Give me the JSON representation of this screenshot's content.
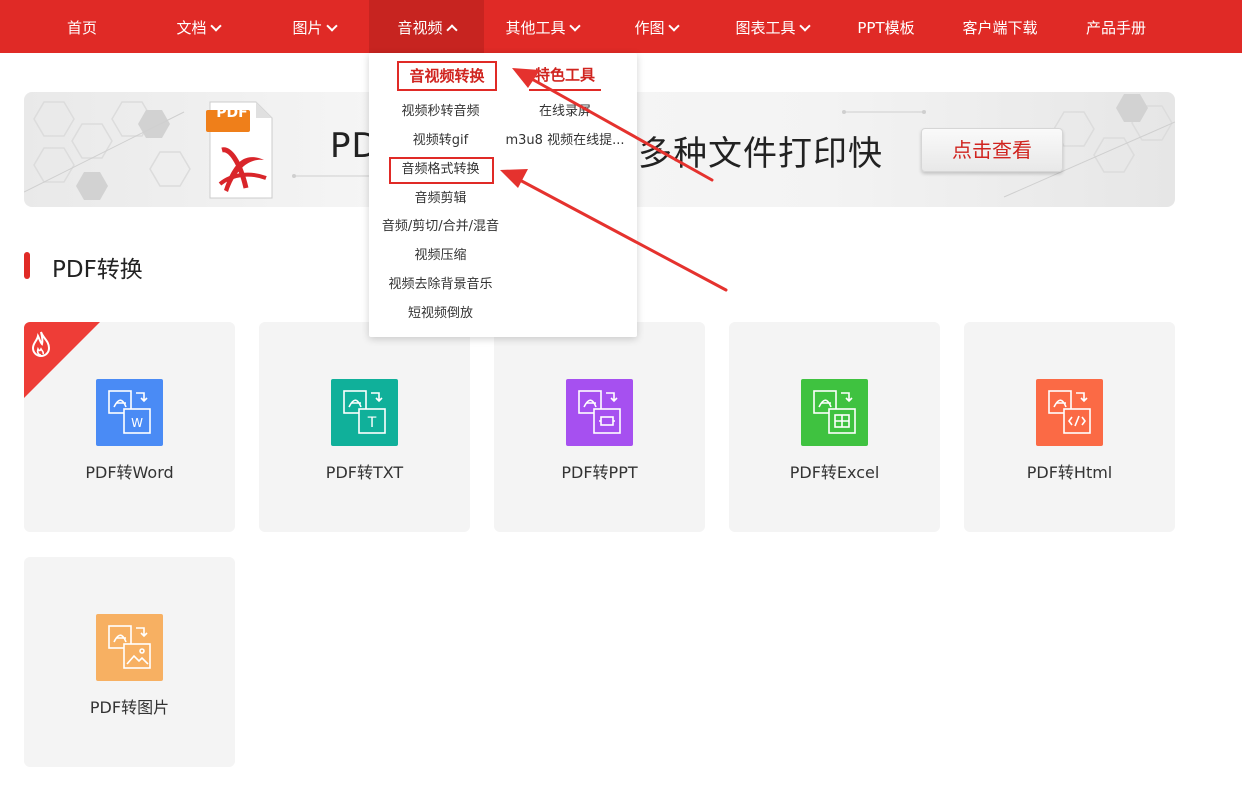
{
  "nav": {
    "items": [
      {
        "label": "首页",
        "has_caret": false
      },
      {
        "label": "文档",
        "has_caret": true
      },
      {
        "label": "图片",
        "has_caret": true
      },
      {
        "label": "音视频",
        "has_caret": true,
        "active": true
      },
      {
        "label": "其他工具",
        "has_caret": true
      },
      {
        "label": "作图",
        "has_caret": true
      },
      {
        "label": "图表工具",
        "has_caret": true
      },
      {
        "label": "PPT模板",
        "has_caret": false
      },
      {
        "label": "客户端下载",
        "has_caret": false
      },
      {
        "label": "产品手册",
        "has_caret": false
      }
    ]
  },
  "dropdown": {
    "left_heading": "音视频转换",
    "right_heading": "特色工具",
    "left_items": [
      "视频秒转音频",
      "视频转gif",
      "音频格式转换",
      "音频剪辑",
      "音频/剪切/合并/混音",
      "视频压缩",
      "视频去除背景音乐",
      "短视频倒放"
    ],
    "right_items": [
      "在线录屏",
      "m3u8 视频在线提..."
    ],
    "highlighted_item": "音频格式转换"
  },
  "banner": {
    "doc_badge": "PDF",
    "text_a": "PD",
    "text_b": "多种文件打印快",
    "button_label": "点击查看"
  },
  "section": {
    "title": "PDF转换"
  },
  "cards": [
    {
      "label": "PDF转Word",
      "icon": "pdf-to-word-icon",
      "color": "#4a8bf5",
      "hot": true
    },
    {
      "label": "PDF转TXT",
      "icon": "pdf-to-txt-icon",
      "color": "#10b09a"
    },
    {
      "label": "PDF转PPT",
      "icon": "pdf-to-ppt-icon",
      "color": "#a650f0"
    },
    {
      "label": "PDF转Excel",
      "icon": "pdf-to-excel-icon",
      "color": "#3fc240"
    },
    {
      "label": "PDF转Html",
      "icon": "pdf-to-html-icon",
      "color": "#fb6a45"
    },
    {
      "label": "PDF转图片",
      "icon": "pdf-to-image-icon",
      "color": "#f7b062"
    }
  ],
  "colors": {
    "brand_red": "#e02a26",
    "card_bg": "#f4f4f4"
  }
}
